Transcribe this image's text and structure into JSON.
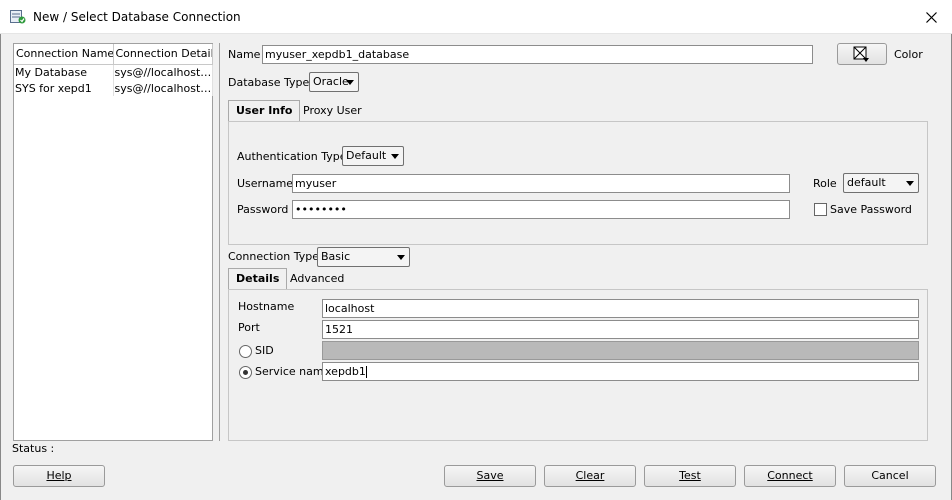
{
  "window": {
    "title": "New / Select Database Connection"
  },
  "connections": {
    "headers": [
      "Connection Name",
      "Connection Details"
    ],
    "rows": [
      [
        "My Database",
        "sys@//localhost:..."
      ],
      [
        "SYS for xepd1",
        "sys@//localhost:..."
      ]
    ]
  },
  "form": {
    "name_label": "Name",
    "name_value": "myuser_xepdb1_database",
    "color_label": "Color",
    "db_type_label": "Database Type",
    "db_type_value": "Oracle",
    "tabs": [
      "User Info",
      "Proxy User"
    ],
    "auth_type_label": "Authentication Type",
    "auth_type_value": "Default",
    "username_label": "Username",
    "username_value": "myuser",
    "password_label": "Password",
    "password_value": "••••••••",
    "role_label": "Role",
    "role_value": "default",
    "save_password_label": "Save Password",
    "conn_type_label": "Connection Type",
    "conn_type_value": "Basic",
    "conn_tabs": [
      "Details",
      "Advanced"
    ],
    "hostname_label": "Hostname",
    "hostname_value": "localhost",
    "port_label": "Port",
    "port_value": "1521",
    "sid_label": "SID",
    "service_name_label": "Service name",
    "service_name_value": "xepdb1"
  },
  "status_label": "Status :",
  "buttons": {
    "help": "Help",
    "save": "Save",
    "clear": "Clear",
    "test": "Test",
    "connect": "Connect",
    "cancel": "Cancel"
  }
}
